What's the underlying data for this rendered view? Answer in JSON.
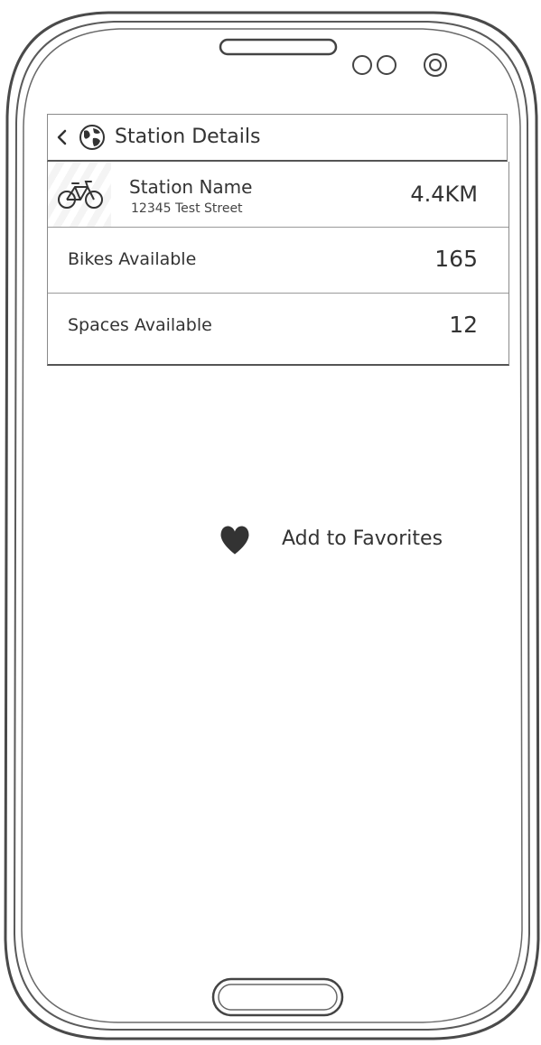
{
  "header": {
    "title": "Station Details",
    "back_icon": "chevron-left-icon",
    "globe_icon": "globe-icon"
  },
  "station": {
    "icon": "bicycle-icon",
    "name": "Station Name",
    "address": "12345 Test Street",
    "distance": "4.4KM"
  },
  "details": [
    {
      "label": "Bikes Available",
      "value": "165"
    },
    {
      "label": "Spaces Available",
      "value": "12"
    }
  ],
  "favorites": {
    "icon": "heart-icon",
    "label": "Add to Favorites"
  },
  "colors": {
    "line": "#555555",
    "text": "#333333",
    "icon": "#444444"
  }
}
